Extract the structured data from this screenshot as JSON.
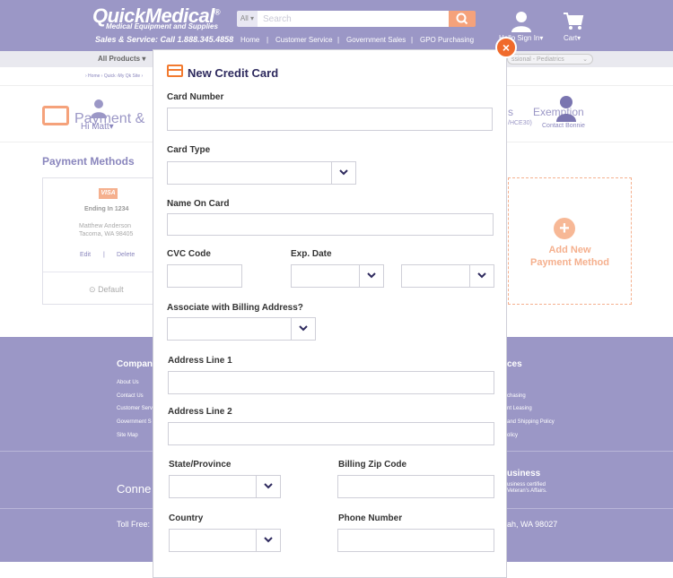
{
  "header": {
    "logo": "QuickMedical",
    "logo_reg": "®",
    "logo_tagline": "Medical Equipment and Supplies",
    "sales_line": "Sales & Service: Call 1.888.345.4858",
    "search_category": "All",
    "search_placeholder": "Search",
    "nav_links": [
      "Home",
      "Customer Service",
      "Government Sales",
      "GPO Purchasing"
    ],
    "user_label": "Hello Sign In",
    "cart_label": "Cart"
  },
  "subnav": {
    "all_products": "All Products",
    "right_pill": "ssional - Pediatrics"
  },
  "breadcrumb": "› Home › Quick ›My Qk Site ›",
  "page": {
    "title": "Payment &",
    "hi_user": "Hi Matt",
    "tax_text": "Exemption",
    "tax_prefix": "s",
    "tax_sub": "/HCE30)",
    "contact_label": "Contact Bonnie",
    "payment_methods_heading": "Payment Methods",
    "saved_card": {
      "brand": "VISA",
      "ending": "Ending In 1234",
      "holder": "Matthew Anderson",
      "city": "Tacoma, WA 98405",
      "edit": "Edit",
      "separator": "|",
      "delete": "Delete",
      "default": "Default"
    },
    "add_new": {
      "line1": "Add New",
      "line2": "Payment Method"
    }
  },
  "footer": {
    "company_heading": "Compan",
    "company_links": [
      "About Us",
      "Contact Us",
      "Customer Servi",
      "Government S",
      "Site Map"
    ],
    "services_heading": "ces",
    "services_links": [
      "chasing",
      "nt Leasing",
      "and Shipping Policy",
      "olicy"
    ],
    "connect_heading": "Conne",
    "business_heading": "usiness",
    "business_lines": [
      "usiness certified",
      "Veteran's Affairs."
    ],
    "toll_free": "Toll Free:",
    "address_tail": "ah, WA 98027"
  },
  "modal": {
    "title": "New Credit Card",
    "close": "×",
    "fields": {
      "card_number": "Card Number",
      "card_type": "Card Type",
      "name_on_card": "Name On Card",
      "cvc_code": "CVC Code",
      "exp_date": "Exp. Date",
      "associate_billing": "Associate with Billing Address?",
      "address_line_1": "Address Line 1",
      "address_line_2": "Address Line 2",
      "state_province": "State/Province",
      "billing_zip": "Billing Zip Code",
      "country": "Country",
      "phone_number": "Phone Number"
    }
  },
  "colors": {
    "brand_purple": "#9b97c6",
    "accent_orange": "#f5a27b",
    "close_orange": "#f06a2b",
    "title_navy": "#2e2a5e"
  }
}
